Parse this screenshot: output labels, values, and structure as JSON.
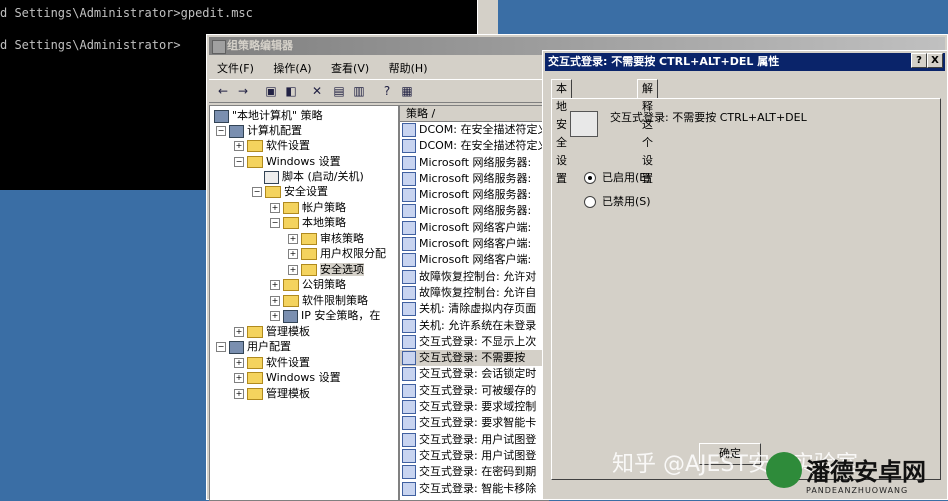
{
  "console": {
    "lines": [
      "d Settings\\Administrator>gpedit.msc",
      "d Settings\\Administrator>"
    ]
  },
  "gpedit": {
    "title": "组策略编辑器",
    "menu": [
      "文件(F)",
      "操作(A)",
      "查看(V)",
      "帮助(H)"
    ],
    "tree": [
      {
        "label": "\"本地计算机\" 策略",
        "icon": "policy-icon"
      },
      {
        "label": "计算机配置",
        "icon": "computer-icon"
      },
      {
        "label": "软件设置",
        "icon": "folder-icon"
      },
      {
        "label": "Windows 设置",
        "icon": "folder-icon"
      },
      {
        "label": "脚本 (启动/关机)",
        "icon": "script-icon"
      },
      {
        "label": "安全设置",
        "icon": "folder-icon"
      },
      {
        "label": "帐户策略",
        "icon": "folder-icon"
      },
      {
        "label": "本地策略",
        "icon": "folder-icon"
      },
      {
        "label": "审核策略",
        "icon": "folder-icon"
      },
      {
        "label": "用户权限分配",
        "icon": "folder-icon"
      },
      {
        "label": "安全选项",
        "icon": "folder-icon"
      },
      {
        "label": "公钥策略",
        "icon": "folder-icon"
      },
      {
        "label": "软件限制策略",
        "icon": "folder-icon"
      },
      {
        "label": "IP 安全策略，在",
        "icon": "folder-icon"
      },
      {
        "label": "管理模板",
        "icon": "folder-icon"
      },
      {
        "label": "用户配置",
        "icon": "user-icon"
      },
      {
        "label": "软件设置",
        "icon": "folder-icon"
      },
      {
        "label": "Windows 设置",
        "icon": "folder-icon"
      },
      {
        "label": "管理模板",
        "icon": "folder-icon"
      }
    ],
    "list_header": "策略",
    "list_items": [
      "DCOM: 在安全描述符定义",
      "DCOM: 在安全描述符定义",
      "Microsoft 网络服务器:",
      "Microsoft 网络服务器:",
      "Microsoft 网络服务器:",
      "Microsoft 网络服务器:",
      "Microsoft 网络客户端:",
      "Microsoft 网络客户端:",
      "Microsoft 网络客户端:",
      "故障恢复控制台: 允许对",
      "故障恢复控制台: 允许自",
      "关机: 清除虚拟内存页面",
      "关机: 允许系统在未登录",
      "交互式登录: 不显示上次",
      "交互式登录: 不需要按",
      "交互式登录: 会话锁定时",
      "交互式登录: 可被缓存的",
      "交互式登录: 要求域控制",
      "交互式登录: 要求智能卡",
      "交互式登录: 用户试图登",
      "交互式登录: 用户试图登",
      "交互式登录: 在密码到期",
      "交互式登录: 智能卡移除"
    ],
    "selected_index": 14
  },
  "dialog": {
    "title": "交互式登录: 不需要按 CTRL+ALT+DEL 属性",
    "help": "?",
    "close": "X",
    "tabs": [
      "本地安全设置",
      "解释这个设置"
    ],
    "policy_name": "交互式登录: 不需要按 CTRL+ALT+DEL",
    "options": [
      "已启用(E)",
      "已禁用(S)"
    ],
    "selected_option": 0,
    "ok": "确定"
  },
  "watermark": "知乎 @AJEST安全实验室",
  "logo": {
    "name": "潘德安卓网",
    "sub": "PANDEANZHUOWANG"
  },
  "colors": {
    "dialog_title": "#0a246a",
    "desktop": "#3a6ea5",
    "console": "#000000"
  }
}
